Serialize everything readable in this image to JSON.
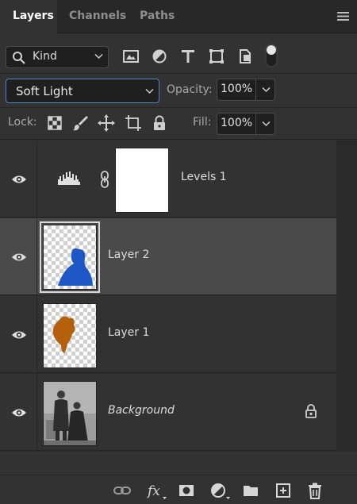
{
  "tabs": [
    {
      "label": "Layers",
      "active": true
    },
    {
      "label": "Channels",
      "active": false
    },
    {
      "label": "Paths",
      "active": false
    }
  ],
  "filter": {
    "kind_label": "Kind",
    "icons": [
      "image-filter-icon",
      "adjustment-filter-icon",
      "type-filter-icon",
      "shape-filter-icon",
      "smart-object-filter-icon",
      "filter-toggle-icon"
    ]
  },
  "blend": {
    "mode": "Soft Light",
    "opacity_label": "Opacity:",
    "opacity_value": "100%"
  },
  "lock": {
    "label": "Lock:",
    "icons": [
      "lock-transparent-pixels-icon",
      "lock-image-pixels-icon",
      "lock-position-icon",
      "lock-artboard-icon",
      "lock-all-icon"
    ],
    "fill_label": "Fill:",
    "fill_value": "100%"
  },
  "layers": [
    {
      "name": "Levels 1",
      "type": "adjustment",
      "visible": true,
      "selected": false
    },
    {
      "name": "Layer 2",
      "type": "pixel",
      "visible": true,
      "selected": true,
      "swatch_color": "#1e58c7"
    },
    {
      "name": "Layer 1",
      "type": "pixel",
      "visible": true,
      "selected": false,
      "swatch_color": "#b5600c"
    },
    {
      "name": "Background",
      "type": "background",
      "visible": true,
      "selected": false,
      "locked": true
    }
  ],
  "bottom_toolbar": [
    "link-layers-icon",
    "fx-icon",
    "add-mask-icon",
    "new-adjustment-icon",
    "new-group-icon",
    "new-layer-icon",
    "delete-icon"
  ],
  "colors": {
    "accent": "#4f86c9",
    "panel": "#323232",
    "selected_row": "#4a4a4a"
  }
}
